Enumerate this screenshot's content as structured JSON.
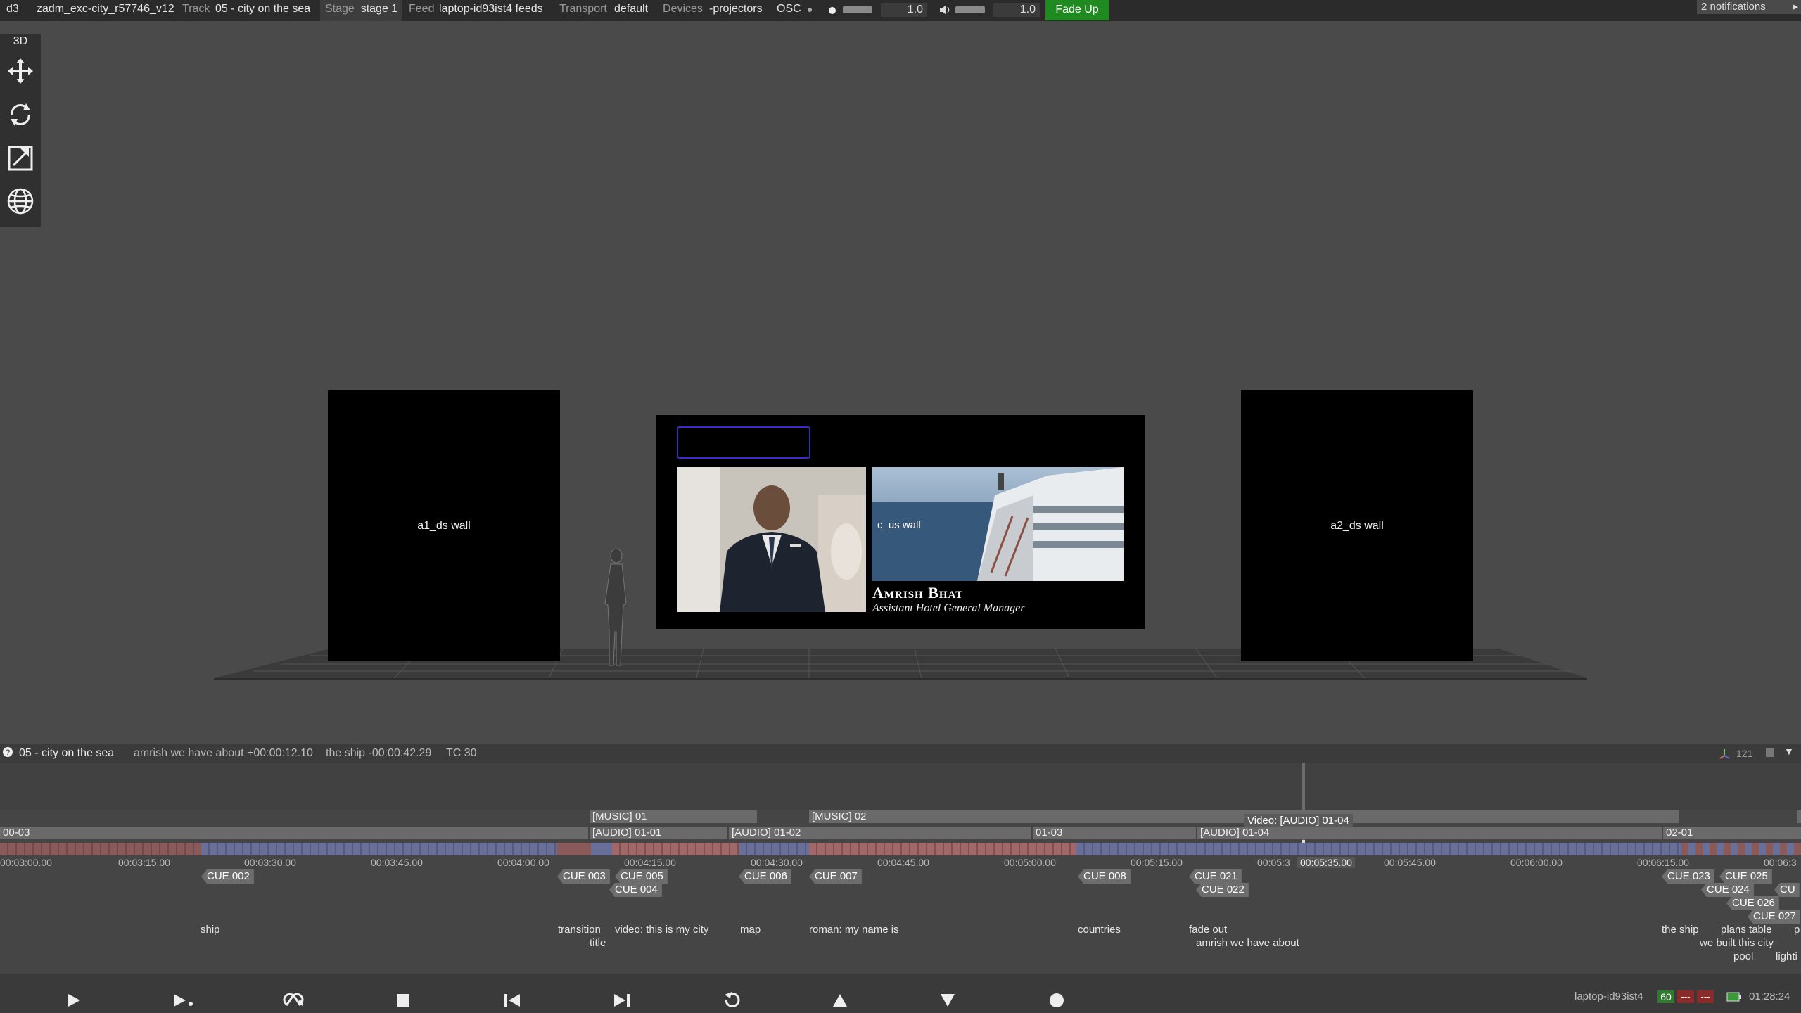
{
  "topbar": {
    "app": "d3",
    "project": "zadm_exc-city_r57746_v12",
    "track_label": "Track",
    "track_value": "05 - city on the sea",
    "stage_label": "Stage",
    "stage_value": "stage 1",
    "feed_label": "Feed",
    "feed_value": "laptop-id93ist4 feeds",
    "transport_label": "Transport",
    "transport_value": "default",
    "devices_label": "Devices",
    "devices_value": "-projectors",
    "osc_label": "OSC",
    "brightness_value": "1.0",
    "volume_value": "1.0",
    "fade_up_label": "Fade Up",
    "notifications": "2 notifications"
  },
  "toolbar": {
    "mode_label": "3D",
    "tools": [
      "move-icon",
      "rotate-icon",
      "scale-icon",
      "globe-icon"
    ]
  },
  "scene": {
    "left_wall": "a1_ds wall",
    "right_wall": "a2_ds wall",
    "center_wall": "c_us wall",
    "lower_third_name": "Amrish Bhat",
    "lower_third_title": "Assistant Hotel General Manager"
  },
  "timeline_header": {
    "track_name": "05 - city on the sea",
    "current_note": "amrish we have about +00:00:12.10",
    "next_note": "the ship -00:00:42.29",
    "tc": "TC 30",
    "zoom_value": "121"
  },
  "timeline": {
    "tooltip": "Video: [AUDIO] 01-04",
    "playhead_time": "00:05:35.00",
    "layers_top": [
      "[MUSIC] 01",
      "[MUSIC] 02"
    ],
    "layers_bottom": [
      "00-03",
      "[AUDIO] 01-01",
      "[AUDIO] 01-02",
      "01-03",
      "[AUDIO] 01-04",
      "02-01"
    ],
    "ticks": [
      "00:03:00.00",
      "00:03:15.00",
      "00:03:30.00",
      "00:03:45.00",
      "00:04:00.00",
      "00:04:15.00",
      "00:04:30.00",
      "00:04:45.00",
      "00:05:00.00",
      "00:05:15.00",
      "00:05:3",
      "00:05:45.00",
      "00:06:00.00",
      "00:06:15.00",
      "00:06:3"
    ],
    "cues": [
      "CUE 002",
      "CUE 003",
      "CUE 004",
      "CUE 005",
      "CUE 006",
      "CUE 007",
      "CUE 008",
      "CUE 021",
      "CUE 022",
      "CUE 023",
      "CUE 024",
      "CUE 025",
      "CUE 026",
      "CUE 027",
      "CU"
    ],
    "notes": [
      "ship",
      "transition",
      "title",
      "video: this is my city",
      "map",
      "roman: my name is",
      "countries",
      "fade out",
      "amrish we have about",
      "the ship",
      "we built this city",
      "plans table",
      "pool",
      "p",
      "lighti"
    ]
  },
  "status": {
    "machine": "laptop-id93ist4",
    "fps": "60",
    "ind1": "---",
    "ind2": "---",
    "clock": "01:28:24"
  },
  "transport": {
    "buttons": [
      "play-icon",
      "play-to-end-icon",
      "loop-icon",
      "stop-icon",
      "previous-section-icon",
      "next-section-icon",
      "return-icon",
      "previous-cue-icon",
      "next-cue-icon",
      "record-icon"
    ]
  },
  "colors": {
    "accent_green": "#1f8a1f",
    "timeline_red": "#8a5a5a",
    "timeline_blue": "#6a6f9a"
  }
}
